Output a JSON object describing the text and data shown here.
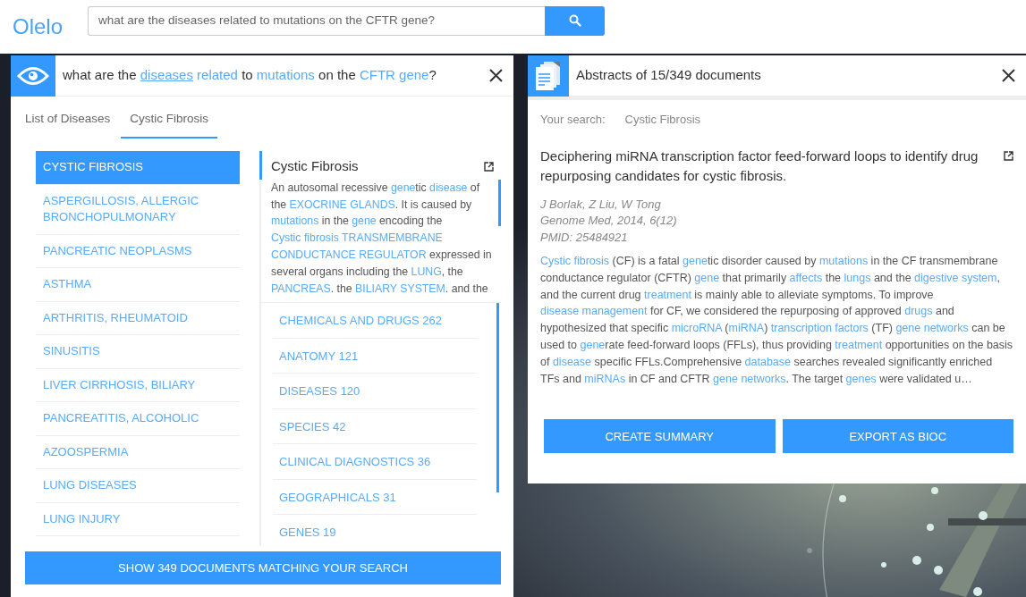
{
  "app": {
    "logo": "Olelo"
  },
  "search": {
    "value": "what are the diseases related to mutations on the CFTR gene?"
  },
  "question_panel": {
    "question": [
      {
        "text": "what are the ",
        "kind": "text"
      },
      {
        "text": "diseases",
        "kind": "link",
        "underlined": true
      },
      {
        "text": "related",
        "kind": "link",
        "underlined": false
      },
      {
        "text": " to ",
        "kind": "text"
      },
      {
        "text": "mutations",
        "kind": "link",
        "underlined": false
      },
      {
        "text": " on the ",
        "kind": "text"
      },
      {
        "text": "CFTR gene",
        "kind": "link",
        "underlined": false
      },
      {
        "text": "?",
        "kind": "text"
      }
    ],
    "tabs": [
      {
        "label": "List of Diseases",
        "selected": false
      },
      {
        "label": "Cystic Fibrosis",
        "selected": true
      }
    ],
    "diseases": [
      {
        "label": "CYSTIC FIBROSIS",
        "selected": true
      },
      {
        "label": "ASPERGILLOSIS, ALLERGIC BRONCHOPULMONARY",
        "selected": false
      },
      {
        "label": "PANCREATIC NEOPLASMS",
        "selected": false
      },
      {
        "label": "ASTHMA",
        "selected": false
      },
      {
        "label": "ARTHRITIS, RHEUMATOID",
        "selected": false
      },
      {
        "label": "SINUSITIS",
        "selected": false
      },
      {
        "label": "LIVER CIRRHOSIS, BILIARY",
        "selected": false
      },
      {
        "label": "PANCREATITIS, ALCOHOLIC",
        "selected": false
      },
      {
        "label": "AZOOSPERMIA",
        "selected": false
      },
      {
        "label": "LUNG DISEASES",
        "selected": false
      },
      {
        "label": "LUNG INJURY",
        "selected": false
      }
    ],
    "detail": {
      "title": "Cystic Fibrosis",
      "description": [
        {
          "text": "An autosomal recessive ",
          "kind": "text"
        },
        {
          "text": "gene",
          "kind": "link"
        },
        {
          "text": "tic ",
          "kind": "text"
        },
        {
          "text": "disease",
          "kind": "link"
        },
        {
          "text": " of the ",
          "kind": "text"
        },
        {
          "text": "EXOCRINE GLANDS",
          "kind": "link"
        },
        {
          "text": ". It is caused by ",
          "kind": "text"
        },
        {
          "text": "mutations",
          "kind": "link"
        },
        {
          "text": " in the ",
          "kind": "text"
        },
        {
          "text": "gene",
          "kind": "link"
        },
        {
          "text": " encoding the ",
          "kind": "text"
        },
        {
          "text": "Cystic fibrosis TRANSMEMBRANE",
          "kind": "link"
        },
        {
          "text": "CONDUCTANCE REGULATOR",
          "kind": "link"
        },
        {
          "text": " expressed in several organs including the ",
          "kind": "text"
        },
        {
          "text": "LUNG",
          "kind": "link"
        },
        {
          "text": ", the ",
          "kind": "text"
        },
        {
          "text": "PANCREAS",
          "kind": "link"
        },
        {
          "text": ". the ",
          "kind": "text"
        },
        {
          "text": "BILIARY SYSTEM",
          "kind": "link"
        },
        {
          "text": ". and the",
          "kind": "text"
        }
      ]
    },
    "categories": [
      {
        "label": "CHEMICALS AND DRUGS 262"
      },
      {
        "label": "ANATOMY 121"
      },
      {
        "label": "DISEASES 120"
      },
      {
        "label": "SPECIES 42"
      },
      {
        "label": "CLINICAL DIAGNOSTICS 36"
      },
      {
        "label": "GEOGRAPHICALS 31"
      },
      {
        "label": "GENES 19"
      }
    ],
    "show_button": "SHOW 349 DOCUMENTS MATCHING YOUR SEARCH"
  },
  "abstracts_panel": {
    "title": "Abstracts of 15/349 documents",
    "search_label": "Your search:",
    "search_value": "Cystic Fibrosis",
    "article": {
      "title": "Deciphering miRNA transcription factor feed-forward loops to identify drug repurposing candidates for cystic fibrosis.",
      "authors": "J Borlak, Z Liu, W Tong",
      "journal": "Genome Med, 2014, 6(12)",
      "pmid": "PMID: 25484921",
      "abstract": [
        {
          "text": "Cystic fibrosis",
          "kind": "link"
        },
        {
          "text": " (CF) is a fatal ",
          "kind": "text"
        },
        {
          "text": "gene",
          "kind": "link"
        },
        {
          "text": "tic disorder caused by ",
          "kind": "text"
        },
        {
          "text": "mutations",
          "kind": "link"
        },
        {
          "text": " in the CF transmembrane conductance regulator (CFTR) ",
          "kind": "text"
        },
        {
          "text": "gene",
          "kind": "link"
        },
        {
          "text": " that primarily ",
          "kind": "text"
        },
        {
          "text": "affects",
          "kind": "link"
        },
        {
          "text": " the ",
          "kind": "text"
        },
        {
          "text": "lungs",
          "kind": "link"
        },
        {
          "text": " and the ",
          "kind": "text"
        },
        {
          "text": "digestive system",
          "kind": "link"
        },
        {
          "text": ", and the current drug ",
          "kind": "text"
        },
        {
          "text": "treatment",
          "kind": "link"
        },
        {
          "text": " is mainly able to alleviate symptoms. To improve ",
          "kind": "text"
        },
        {
          "text": "disease management",
          "kind": "link"
        },
        {
          "text": " for CF, we considered the repurposing of approved ",
          "kind": "text"
        },
        {
          "text": "drugs",
          "kind": "link"
        },
        {
          "text": " and hypothesized that specific ",
          "kind": "text"
        },
        {
          "text": "microRNA",
          "kind": "link"
        },
        {
          "text": " (",
          "kind": "text"
        },
        {
          "text": "miRNA",
          "kind": "link"
        },
        {
          "text": ") ",
          "kind": "text"
        },
        {
          "text": "transcription",
          "kind": "link"
        },
        {
          "text": "factors",
          "kind": "link"
        },
        {
          "text": " (TF) ",
          "kind": "text"
        },
        {
          "text": "gene networks",
          "kind": "link"
        },
        {
          "text": " can be used to ",
          "kind": "text"
        },
        {
          "text": "gene",
          "kind": "link"
        },
        {
          "text": "rate feed-forward loops (FFLs), thus providing ",
          "kind": "text"
        },
        {
          "text": "treatment",
          "kind": "link"
        },
        {
          "text": " opportunities on the basis of ",
          "kind": "text"
        },
        {
          "text": "disease",
          "kind": "link"
        },
        {
          "text": " specific FFLs.Comprehensive ",
          "kind": "text"
        },
        {
          "text": "database",
          "kind": "link"
        },
        {
          "text": " searches revealed significantly enriched TFs and ",
          "kind": "text"
        },
        {
          "text": "miRNAs",
          "kind": "link"
        },
        {
          "text": " in CF and CFTR ",
          "kind": "text"
        },
        {
          "text": "gene networks",
          "kind": "link"
        },
        {
          "text": ". The target ",
          "kind": "text"
        },
        {
          "text": "genes",
          "kind": "link"
        },
        {
          "text": " were validated u…",
          "kind": "text"
        }
      ]
    },
    "buttons": [
      "CREATE SUMMARY",
      "EXPORT AS BIOC"
    ]
  }
}
